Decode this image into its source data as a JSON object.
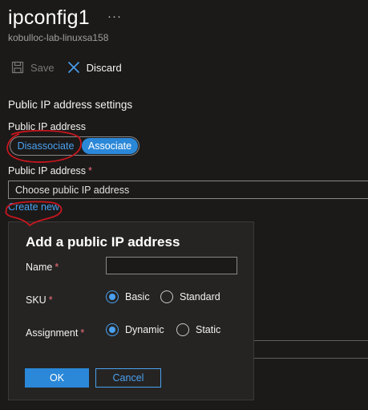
{
  "header": {
    "title": "ipconfig1",
    "more": "···",
    "subtitle": "kobulloc-lab-linuxsa158"
  },
  "toolbar": {
    "save_label": "Save",
    "discard_label": "Discard"
  },
  "settings": {
    "section_title": "Public IP address settings",
    "public_ip_label": "Public IP address",
    "toggle_options": [
      "Disassociate",
      "Associate"
    ],
    "toggle_selected": "Associate",
    "public_ip_select_label": "Public IP address",
    "required_mark": "*",
    "dropdown_placeholder": "Choose public IP address",
    "create_new_link": "Create new"
  },
  "dialog": {
    "title": "Add a public IP address",
    "name_label": "Name",
    "name_value": "",
    "sku_label": "SKU",
    "sku_options": [
      "Basic",
      "Standard"
    ],
    "sku_selected": "Basic",
    "assignment_label": "Assignment",
    "assignment_options": [
      "Dynamic",
      "Static"
    ],
    "assignment_selected": "Dynamic",
    "ok_label": "OK",
    "cancel_label": "Cancel"
  },
  "colors": {
    "accent": "#2b88d8",
    "link": "#4aa0f0",
    "annotation": "#c7161e",
    "background": "#1b1a19"
  }
}
